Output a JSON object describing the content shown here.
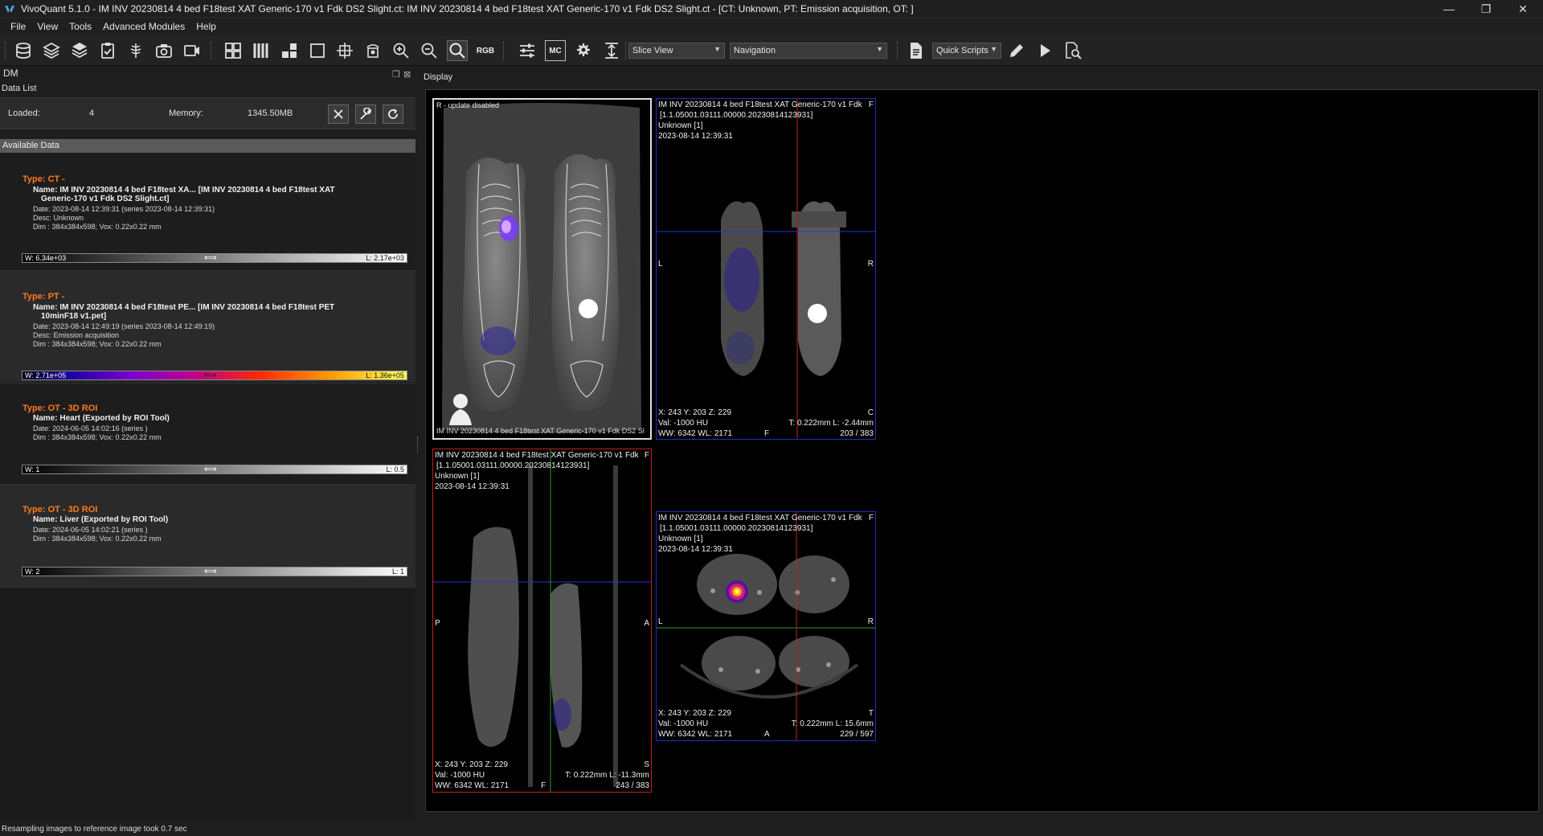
{
  "window": {
    "title": "VivoQuant 5.1.0 - IM INV 20230814 4 bed F18test XAT Generic-170 v1 Fdk DS2 Slight.ct: IM INV 20230814 4 bed F18test XAT Generic-170 v1 Fdk DS2 Slight.ct - [CT: Unknown, PT: Emission acquisition, OT: ]",
    "minimize": "—",
    "restore": "❐",
    "close": "✕"
  },
  "menu": [
    "File",
    "View",
    "Tools",
    "Advanced Modules",
    "Help"
  ],
  "toolbar": {
    "rgb_label": "RGB",
    "mc_label": "MC",
    "slice_view": "Slice View",
    "navigation": "Navigation",
    "quick_scripts": "Quick Scripts"
  },
  "dm": {
    "panel_title": "DM",
    "data_list_label": "Data List",
    "loaded_label": "Loaded:",
    "loaded_value": "4",
    "memory_label": "Memory:",
    "memory_value": "1345.50MB",
    "available_label": "Available Data"
  },
  "items": [
    {
      "type": "Type: CT -",
      "name1": "Name: IM INV 20230814 4 bed F18test XA... [IM INV 20230814 4 bed F18test XAT",
      "name2": "Generic-170 v1 Fdk DS2 Slight.ct]",
      "date": "Date: 2023-08-14 12:39:31 (series 2023-08-14 12:39:31)",
      "desc": "Desc: Unknown",
      "dim": "Dim : 384x384x598; Vox: 0.22x0.22 mm",
      "w": "W: 6.34e+03",
      "l": "L: 2.17e+03",
      "colormap": "gray"
    },
    {
      "type": "Type: PT -",
      "name1": "Name: IM INV 20230814 4 bed F18test PE... [IM INV 20230814 4 bed F18test PET",
      "name2": "10minF18 v1.pet]",
      "date": "Date: 2023-08-14 12:49:19 (series 2023-08-14 12:49:19)",
      "desc": "Desc: Emission acquisition",
      "dim": "Dim : 384x384x598; Vox: 0.22x0.22 mm",
      "w": "W: 2.71e+05",
      "l": "L: 1.36e+05",
      "colormap": "hot"
    },
    {
      "type": "Type: OT - 3D ROI",
      "name1": "Name: Heart (Exported by ROI Tool)",
      "date": "Date: 2024-06-05 14:02:16 (series )",
      "dim": "Dim : 384x384x598; Vox: 0.22x0.22 mm",
      "w": "W: 1",
      "l": "L: 0.5",
      "colormap": "gray"
    },
    {
      "type": "Type: OT - 3D ROI",
      "name1": "Name: Liver (Exported by ROI Tool)",
      "date": "Date: 2024-06-05 14:02:21 (series )",
      "dim": "Dim : 384x384x598; Vox: 0.22x0.22 mm",
      "w": "W: 2",
      "l": "L: 1",
      "colormap": "gray"
    }
  ],
  "display": {
    "label": "Display",
    "mip": {
      "status": "R - update disabled",
      "caption": "IM INV 20230814 4 bed F18test XAT Generic-170 v1 Fdk DS2 Sl"
    },
    "coronal": {
      "line1": "IM INV 20230814 4 bed F18test XAT Generic-170 v1 Fdk",
      "uid": "[1.1.05001.03111.00000.20230814123931]",
      "patient": "Unknown [1]",
      "date": "2023-08-14 12:39:31",
      "left": "L",
      "right": "R",
      "corner_tr": "F",
      "pos": "X: 243 Y: 203 Z: 229",
      "val": "Val: -1000 HU",
      "wwwl": "WW: 6342 WL: 2171",
      "bottom": "F",
      "corner_br": "C",
      "thick": "T: 0.222mm L: -2.44mm",
      "slice": "203 / 383"
    },
    "sagittal": {
      "line1": "IM INV 20230814 4 bed F18test XAT Generic-170 v1 Fdk",
      "uid": "[1.1.05001.03111.00000.20230814123931]",
      "patient": "Unknown [1]",
      "date": "2023-08-14 12:39:31",
      "left": "P",
      "right": "A",
      "corner_tr": "F",
      "pos": "X: 243 Y: 203 Z: 229",
      "val": "Val: -1000 HU",
      "wwwl": "WW: 6342 WL: 2171",
      "bottom": "F",
      "corner_br": "S",
      "thick": "T: 0.222mm L: -11.3mm",
      "slice": "243 / 383"
    },
    "axial": {
      "line1": "IM INV 20230814 4 bed F18test XAT Generic-170 v1 Fdk",
      "uid": "[1.1.05001.03111.00000.20230814123931]",
      "patient": "Unknown [1]",
      "date": "2023-08-14 12:39:31",
      "left": "L",
      "right": "R",
      "corner_tr": "F",
      "pos": "X: 243 Y: 203 Z: 229",
      "val": "Val: -1000 HU",
      "wwwl": "WW: 6342 WL: 2171",
      "bottom": "A",
      "corner_br": "T",
      "thick": "T: 0.222mm L: 15.6mm",
      "slice": "229 / 597"
    }
  },
  "status": "Resampling images to reference image took 0.7 sec"
}
